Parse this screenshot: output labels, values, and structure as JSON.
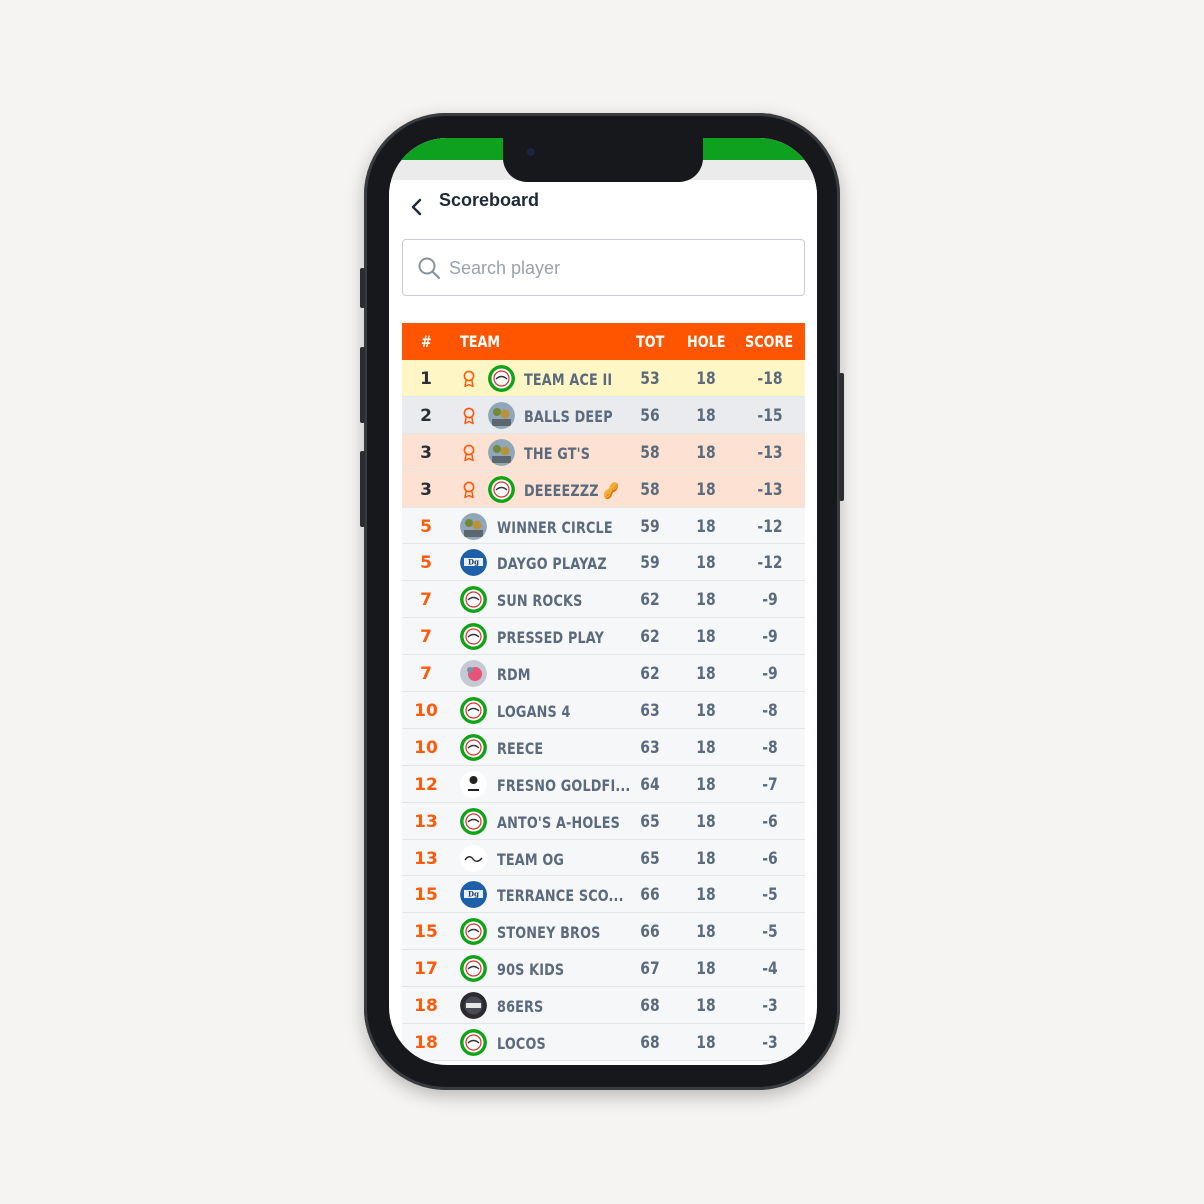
{
  "header": {
    "title": "Scoreboard"
  },
  "search": {
    "placeholder": "Search player"
  },
  "columns": {
    "rank": "#",
    "team": "TEAM",
    "tot": "TOT",
    "hole": "HOLE",
    "score": "SCORE"
  },
  "colors": {
    "accent": "#ff5500",
    "top_bar": "#0ea11f",
    "gold_row": "#fff6c6",
    "silver_row": "#e9ebee",
    "bronze_row": "#fde1d2"
  },
  "rows": [
    {
      "rank": "1",
      "team": "TEAM ACE II",
      "tot": "53",
      "hole": "18",
      "score": "-18",
      "medal": "gold",
      "avatar": "green-logo-icon"
    },
    {
      "rank": "2",
      "team": "BALLS DEEP",
      "tot": "56",
      "hole": "18",
      "score": "-15",
      "medal": "silver",
      "avatar": "photo-avatar-icon"
    },
    {
      "rank": "3",
      "team": "THE GT'S",
      "tot": "58",
      "hole": "18",
      "score": "-13",
      "medal": "bronze",
      "avatar": "photo-avatar-icon"
    },
    {
      "rank": "3",
      "team": "DEEEEZZZ 🥜",
      "tot": "58",
      "hole": "18",
      "score": "-13",
      "medal": "bronze",
      "avatar": "green-logo-icon"
    },
    {
      "rank": "5",
      "team": "WINNER CIRCLE",
      "tot": "59",
      "hole": "18",
      "score": "-12",
      "avatar": "photo-avatar-icon"
    },
    {
      "rank": "5",
      "team": "DAYGO PLAYAZ",
      "tot": "59",
      "hole": "18",
      "score": "-12",
      "avatar": "blue-logo-icon"
    },
    {
      "rank": "7",
      "team": "SUN ROCKS",
      "tot": "62",
      "hole": "18",
      "score": "-9",
      "avatar": "green-logo-icon"
    },
    {
      "rank": "7",
      "team": "PRESSED PLAY",
      "tot": "62",
      "hole": "18",
      "score": "-9",
      "avatar": "green-logo-icon"
    },
    {
      "rank": "7",
      "team": "RDM",
      "tot": "62",
      "hole": "18",
      "score": "-9",
      "avatar": "pink-photo-icon"
    },
    {
      "rank": "10",
      "team": "LOGANS 4",
      "tot": "63",
      "hole": "18",
      "score": "-8",
      "avatar": "green-logo-icon"
    },
    {
      "rank": "10",
      "team": "REECE",
      "tot": "63",
      "hole": "18",
      "score": "-8",
      "avatar": "green-logo-icon"
    },
    {
      "rank": "12",
      "team": "FRESNO GOLDFI...",
      "tot": "64",
      "hole": "18",
      "score": "-7",
      "avatar": "sketch-logo-icon"
    },
    {
      "rank": "13",
      "team": "ANTO'S A-HOLES",
      "tot": "65",
      "hole": "18",
      "score": "-6",
      "avatar": "green-logo-icon"
    },
    {
      "rank": "13",
      "team": "TEAM OG",
      "tot": "65",
      "hole": "18",
      "score": "-6",
      "avatar": "script-logo-icon"
    },
    {
      "rank": "15",
      "team": "TERRANCE SCO...",
      "tot": "66",
      "hole": "18",
      "score": "-5",
      "avatar": "blue-logo-icon"
    },
    {
      "rank": "15",
      "team": "STONEY BROS",
      "tot": "66",
      "hole": "18",
      "score": "-5",
      "avatar": "green-logo-icon"
    },
    {
      "rank": "17",
      "team": "90S KIDS",
      "tot": "67",
      "hole": "18",
      "score": "-4",
      "avatar": "green-logo-icon"
    },
    {
      "rank": "18",
      "team": "86ERS",
      "tot": "68",
      "hole": "18",
      "score": "-3",
      "avatar": "dark-logo-icon"
    },
    {
      "rank": "18",
      "team": "LOCOS",
      "tot": "68",
      "hole": "18",
      "score": "-3",
      "avatar": "green-logo-icon"
    }
  ]
}
